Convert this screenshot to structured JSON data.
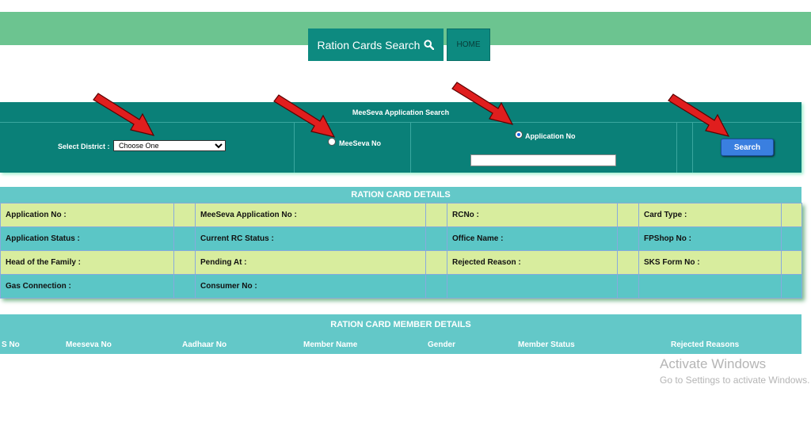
{
  "nav": {
    "search_label": "Ration Cards Search",
    "home_label": "HOME"
  },
  "search_panel": {
    "title": "MeeSeva Application Search",
    "district_label": "Select District :",
    "district_selected": "Choose One",
    "radio_meeseva_label": "MeeSeva No",
    "radio_app_label": "Application No",
    "search_button": "Search"
  },
  "details": {
    "title": "RATION CARD DETAILS",
    "rows": [
      [
        "Application No :",
        "MeeSeva Application No :",
        "RCNo :",
        "Card Type :"
      ],
      [
        "Application Status :",
        "Current RC Status :",
        "Office Name :",
        "FPShop No :"
      ],
      [
        "Head of the Family :",
        "Pending At :",
        "Rejected Reason :",
        "SKS Form No :"
      ],
      [
        "Gas Connection :",
        "Consumer No :",
        "",
        ""
      ]
    ]
  },
  "members": {
    "title": "RATION CARD MEMBER DETAILS",
    "columns": [
      "S No",
      "Meeseva No",
      "Aadhaar No",
      "Member Name",
      "Gender",
      "Member Status",
      "Rejected Reasons"
    ]
  },
  "watermark": {
    "line1": "Activate Windows",
    "line2": "Go to Settings to activate Windows."
  },
  "colors": {
    "teal": "#0a8078",
    "light_teal": "#63c8c8",
    "green_band": "#6cc490",
    "row_green": "#d8ed9e",
    "arrow_red": "#e01e1e"
  }
}
